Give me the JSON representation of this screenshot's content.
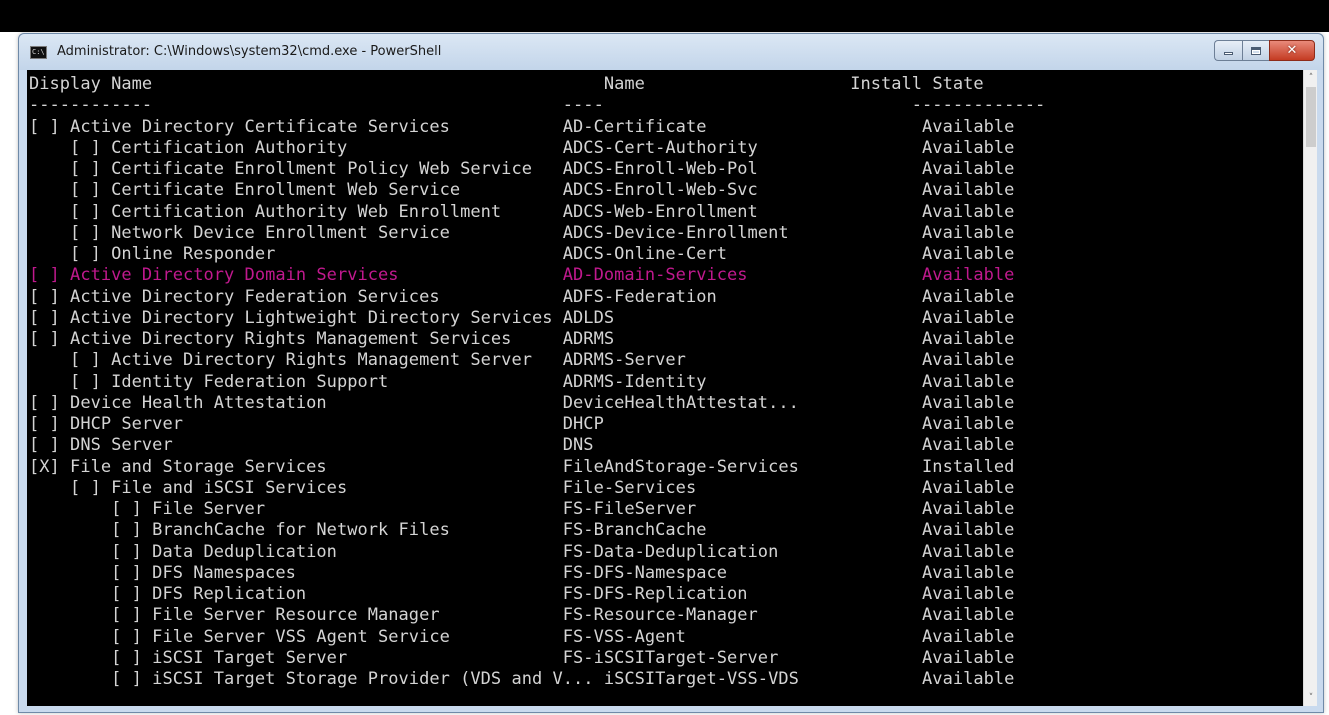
{
  "window": {
    "title": "Administrator: C:\\Windows\\system32\\cmd.exe - PowerShell",
    "icon_text": "C:\\",
    "controls": {
      "minimize_icon": "minimize-icon",
      "maximize_icon": "maximize-icon",
      "close_label": "✕"
    }
  },
  "console": {
    "header": {
      "display_name": "Display Name",
      "name": "Name",
      "install_state": "Install State"
    },
    "divider_line": "------------                                        ----                              -------------",
    "lines": [
      "[ ] Active Directory Certificate Services           AD-Certificate                     Available",
      "    [ ] Certification Authority                     ADCS-Cert-Authority                Available",
      "    [ ] Certificate Enrollment Policy Web Service   ADCS-Enroll-Web-Pol                Available",
      "    [ ] Certificate Enrollment Web Service          ADCS-Enroll-Web-Svc                Available",
      "    [ ] Certification Authority Web Enrollment      ADCS-Web-Enrollment                Available",
      "    [ ] Network Device Enrollment Service           ADCS-Device-Enrollment             Available",
      "    [ ] Online Responder                            ADCS-Online-Cert                   Available",
      "[ ] Active Directory Domain Services                AD-Domain-Services                 Available",
      "[ ] Active Directory Federation Services            ADFS-Federation                    Available",
      "[ ] Active Directory Lightweight Directory Services ADLDS                              Available",
      "[ ] Active Directory Rights Management Services     ADRMS                              Available",
      "    [ ] Active Directory Rights Management Server   ADRMS-Server                       Available",
      "    [ ] Identity Federation Support                 ADRMS-Identity                     Available",
      "[ ] Device Health Attestation                       DeviceHealthAttestat...            Available",
      "[ ] DHCP Server                                     DHCP                               Available",
      "[ ] DNS Server                                      DNS                                Available",
      "[X] File and Storage Services                       FileAndStorage-Services            Installed",
      "    [ ] File and iSCSI Services                     File-Services                      Available",
      "        [ ] File Server                             FS-FileServer                      Available",
      "        [ ] BranchCache for Network Files           FS-BranchCache                     Available",
      "        [ ] Data Deduplication                      FS-Data-Deduplication              Available",
      "        [ ] DFS Namespaces                          FS-DFS-Namespace                   Available",
      "        [ ] DFS Replication                         FS-DFS-Replication                 Available",
      "        [ ] File Server Resource Manager            FS-Resource-Manager                Available",
      "        [ ] File Server VSS Agent Service           FS-VSS-Agent                       Available",
      "        [ ] iSCSI Target Server                     FS-iSCSITarget-Server              Available",
      "        [ ] iSCSI Target Storage Provider (VDS and V... iSCSITarget-VSS-VDS            Available"
    ],
    "highlight_index": 7,
    "colors": {
      "background": "#000000",
      "text": "#d4d4d4",
      "highlight": "#c0198e"
    }
  },
  "scrollbar": {
    "up_arrow": "˄",
    "down_arrow": "˅"
  }
}
